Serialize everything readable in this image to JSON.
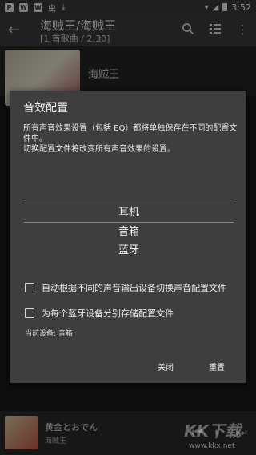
{
  "status_bar": {
    "time": "3:52"
  },
  "toolbar": {
    "title": "海贼王/海贼王",
    "subtitle": "[1 首歌曲 / 2:30]"
  },
  "album": {
    "name": "海贼王"
  },
  "dialog": {
    "title": "音效配置",
    "description_line1": "所有声音效果设置（包括 EQ）都将单独保存在不同的配置文件中。",
    "description_line2": "切换配置文件将改变所有声音效果的设置。",
    "picker_items": [
      "耳机",
      "音箱",
      "蓝牙"
    ],
    "option1": "自动根据不同的声音输出设备切换声音配置文件",
    "option2": "为每个蓝牙设备分别存储配置文件",
    "current_device": "当前设备: 音箱",
    "close_label": "关闭",
    "reset_label": "重置"
  },
  "now_playing": {
    "title": "黄金とおでん",
    "artist": "海贼王"
  },
  "watermark": {
    "logo": "KK下载",
    "url": "www.kkx.net"
  }
}
